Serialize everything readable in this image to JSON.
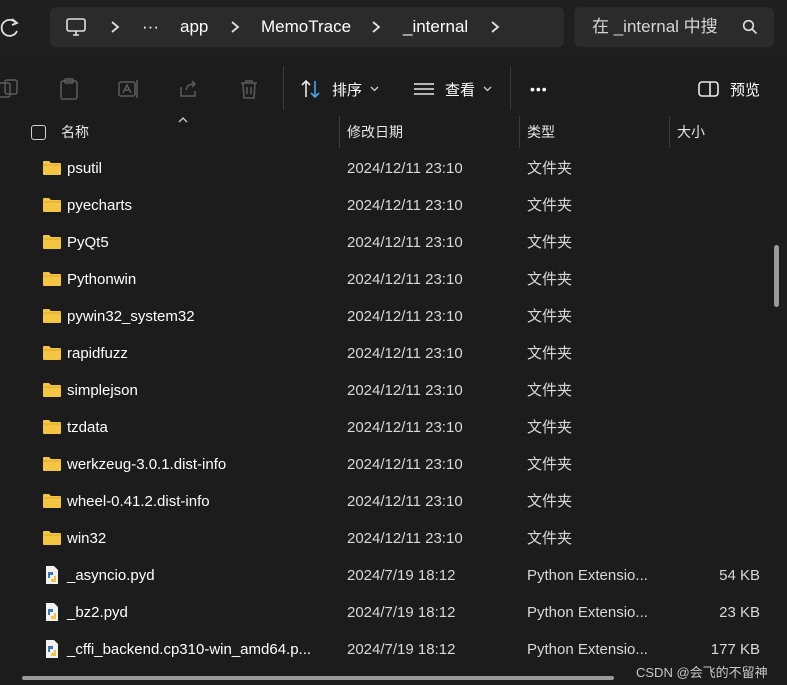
{
  "address_bar": {
    "overflow": "···",
    "crumbs": [
      "app",
      "MemoTrace",
      "_internal"
    ]
  },
  "search": {
    "placeholder": "在 _internal 中搜"
  },
  "toolbar": {
    "sort_label": "排序",
    "view_label": "查看",
    "more_label": "•••",
    "preview_label": "预览"
  },
  "columns": {
    "name": "名称",
    "modified": "修改日期",
    "type": "类型",
    "size": "大小"
  },
  "rows": [
    {
      "name": "psutil",
      "date": "2024/12/11 23:10",
      "type": "文件夹",
      "size": "",
      "icon": "folder-icon"
    },
    {
      "name": "pyecharts",
      "date": "2024/12/11 23:10",
      "type": "文件夹",
      "size": "",
      "icon": "folder-icon"
    },
    {
      "name": "PyQt5",
      "date": "2024/12/11 23:10",
      "type": "文件夹",
      "size": "",
      "icon": "folder-icon"
    },
    {
      "name": "Pythonwin",
      "date": "2024/12/11 23:10",
      "type": "文件夹",
      "size": "",
      "icon": "folder-icon"
    },
    {
      "name": "pywin32_system32",
      "date": "2024/12/11 23:10",
      "type": "文件夹",
      "size": "",
      "icon": "folder-icon"
    },
    {
      "name": "rapidfuzz",
      "date": "2024/12/11 23:10",
      "type": "文件夹",
      "size": "",
      "icon": "folder-icon"
    },
    {
      "name": "simplejson",
      "date": "2024/12/11 23:10",
      "type": "文件夹",
      "size": "",
      "icon": "folder-icon"
    },
    {
      "name": "tzdata",
      "date": "2024/12/11 23:10",
      "type": "文件夹",
      "size": "",
      "icon": "folder-icon"
    },
    {
      "name": "werkzeug-3.0.1.dist-info",
      "date": "2024/12/11 23:10",
      "type": "文件夹",
      "size": "",
      "icon": "folder-icon"
    },
    {
      "name": "wheel-0.41.2.dist-info",
      "date": "2024/12/11 23:10",
      "type": "文件夹",
      "size": "",
      "icon": "folder-icon"
    },
    {
      "name": "win32",
      "date": "2024/12/11 23:10",
      "type": "文件夹",
      "size": "",
      "icon": "folder-icon"
    },
    {
      "name": "_asyncio.pyd",
      "date": "2024/7/19 18:12",
      "type": "Python Extensio...",
      "size": "54 KB",
      "icon": "python-file-icon"
    },
    {
      "name": "_bz2.pyd",
      "date": "2024/7/19 18:12",
      "type": "Python Extensio...",
      "size": "23 KB",
      "icon": "python-file-icon"
    },
    {
      "name": "_cffi_backend.cp310-win_amd64.p...",
      "date": "2024/7/19 18:12",
      "type": "Python Extensio...",
      "size": "177 KB",
      "icon": "python-file-icon"
    }
  ],
  "watermark": "CSDN @会飞的不留神",
  "colors": {
    "background": "#1c1c1c",
    "panel": "#2b2b2b",
    "folder": "#f4c542",
    "accent_blue": "#4aa3f0"
  }
}
